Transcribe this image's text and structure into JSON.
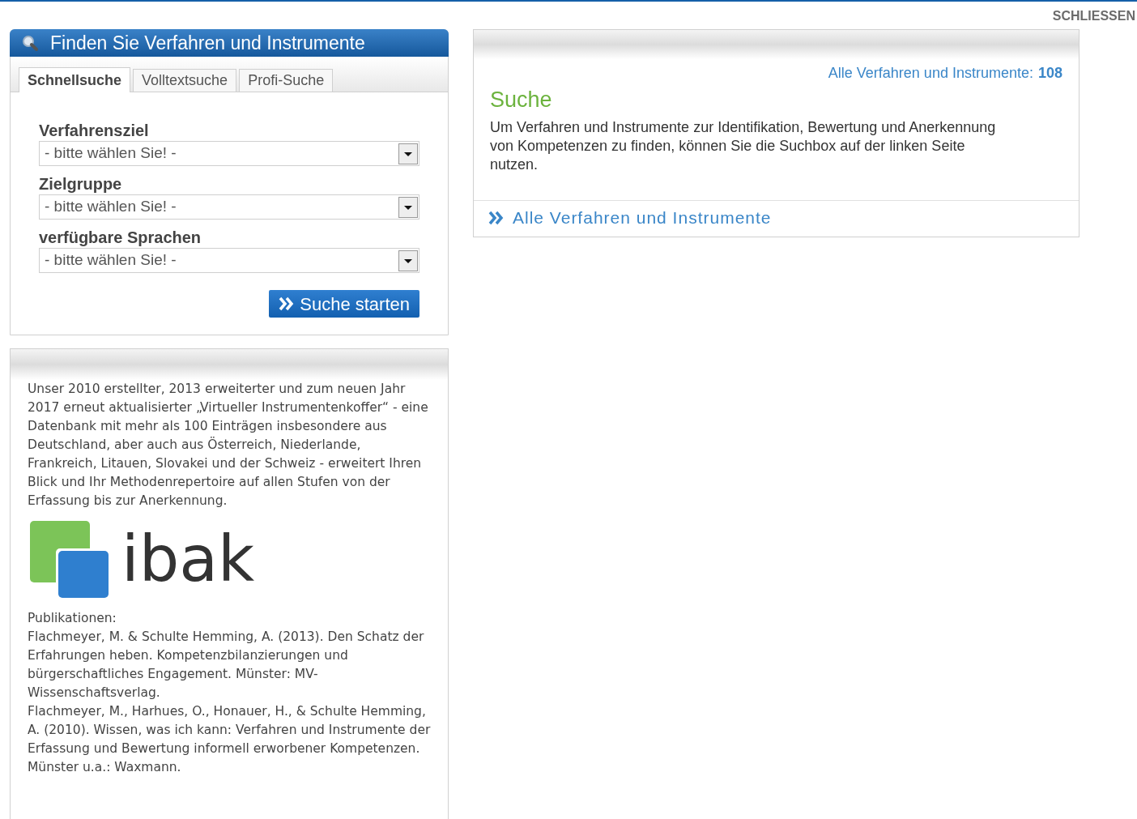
{
  "close_link": "SCHLIESSEN",
  "search_box": {
    "title": "Finden Sie Verfahren und Instrumente",
    "tabs": [
      {
        "label": "Schnellsuche",
        "selected": true
      },
      {
        "label": "Volltextsuche",
        "selected": false
      },
      {
        "label": "Profi-Suche",
        "selected": false
      }
    ],
    "filters": [
      {
        "label": "Verfahrensziel",
        "value": "- bitte wählen Sie! -"
      },
      {
        "label": "Zielgruppe",
        "value": "- bitte wählen Sie! -"
      },
      {
        "label": "verfügbare Sprachen",
        "value": "- bitte wählen Sie! -"
      }
    ],
    "submit": "Suche starten"
  },
  "info_box": {
    "intro": "Unser 2010 erstellter, 2013 erweiterter und zum neuen Jahr 2017 erneut aktualisierter „Virtueller Instrumentenkoffer“ - eine Datenbank mit mehr als 100 Einträgen insbesondere aus Deutschland, aber auch aus Österreich, Niederlande, Frankreich, Litauen, Slovakei und der Schweiz - erweitert Ihren Blick und Ihr Methodenrepertoire auf allen Stufen von der Erfassung bis zur Anerkennung.",
    "logo_text": "ibak",
    "publications_heading": "Publikationen:",
    "publications": [
      "Flachmeyer, M. & Schulte Hemming, A. (2013). Den Schatz der Erfahrungen heben. Kompetenzbilanzierungen und bürgerschaftliches Engagement. Münster: MV-Wissenschaftsverlag.",
      "Flachmeyer, M., Harhues, O., Honauer, H., & Schulte Hemming, A. (2010). Wissen, was ich kann: Verfahren und Instrumente der Erfassung und Bewertung informell erworbener Kompetenzen. Münster u.a.: Waxmann."
    ]
  },
  "results_panel": {
    "count_label": "Alle Verfahren und Instrumente:",
    "count": "108",
    "heading": "Suche",
    "description": "Um Verfahren und Instrumente zur Identifikation, Bewertung und Anerkennung von Kompetenzen zu finden, können Sie die Suchbox auf der linken Seite nutzen.",
    "link": "Alle Verfahren und Instrumente"
  }
}
